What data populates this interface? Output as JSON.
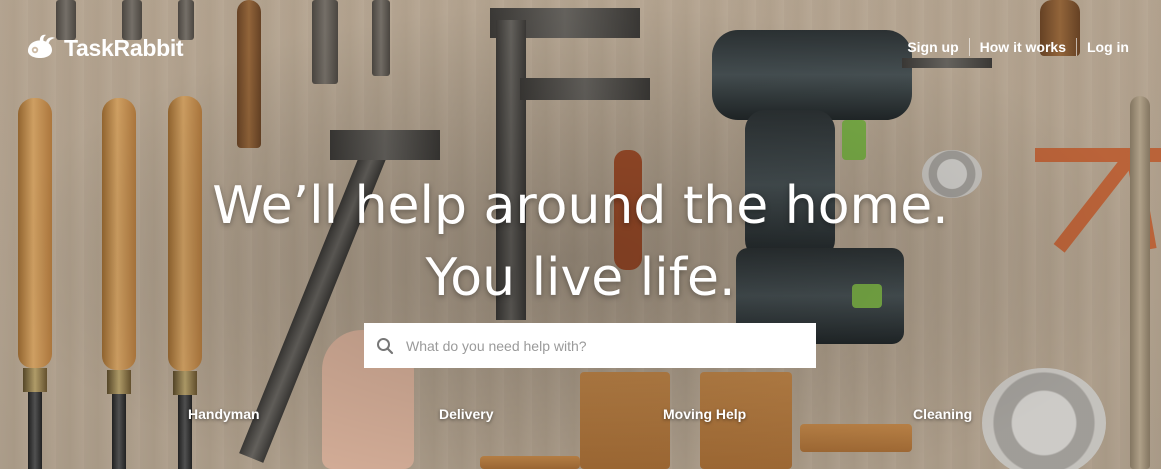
{
  "brand": {
    "name": "TaskRabbit"
  },
  "nav": {
    "sign_up": "Sign up",
    "how_it_works": "How it works",
    "log_in": "Log in"
  },
  "hero": {
    "line1": "We’ll help around the home.",
    "line2": "You live life."
  },
  "search": {
    "placeholder": "What do you need help with?"
  },
  "categories": [
    "Handyman",
    "Delivery",
    "Moving Help",
    "Cleaning"
  ],
  "colors": {
    "text": "#ffffff",
    "search_bg": "#ffffff",
    "placeholder": "#9a9a9a"
  }
}
